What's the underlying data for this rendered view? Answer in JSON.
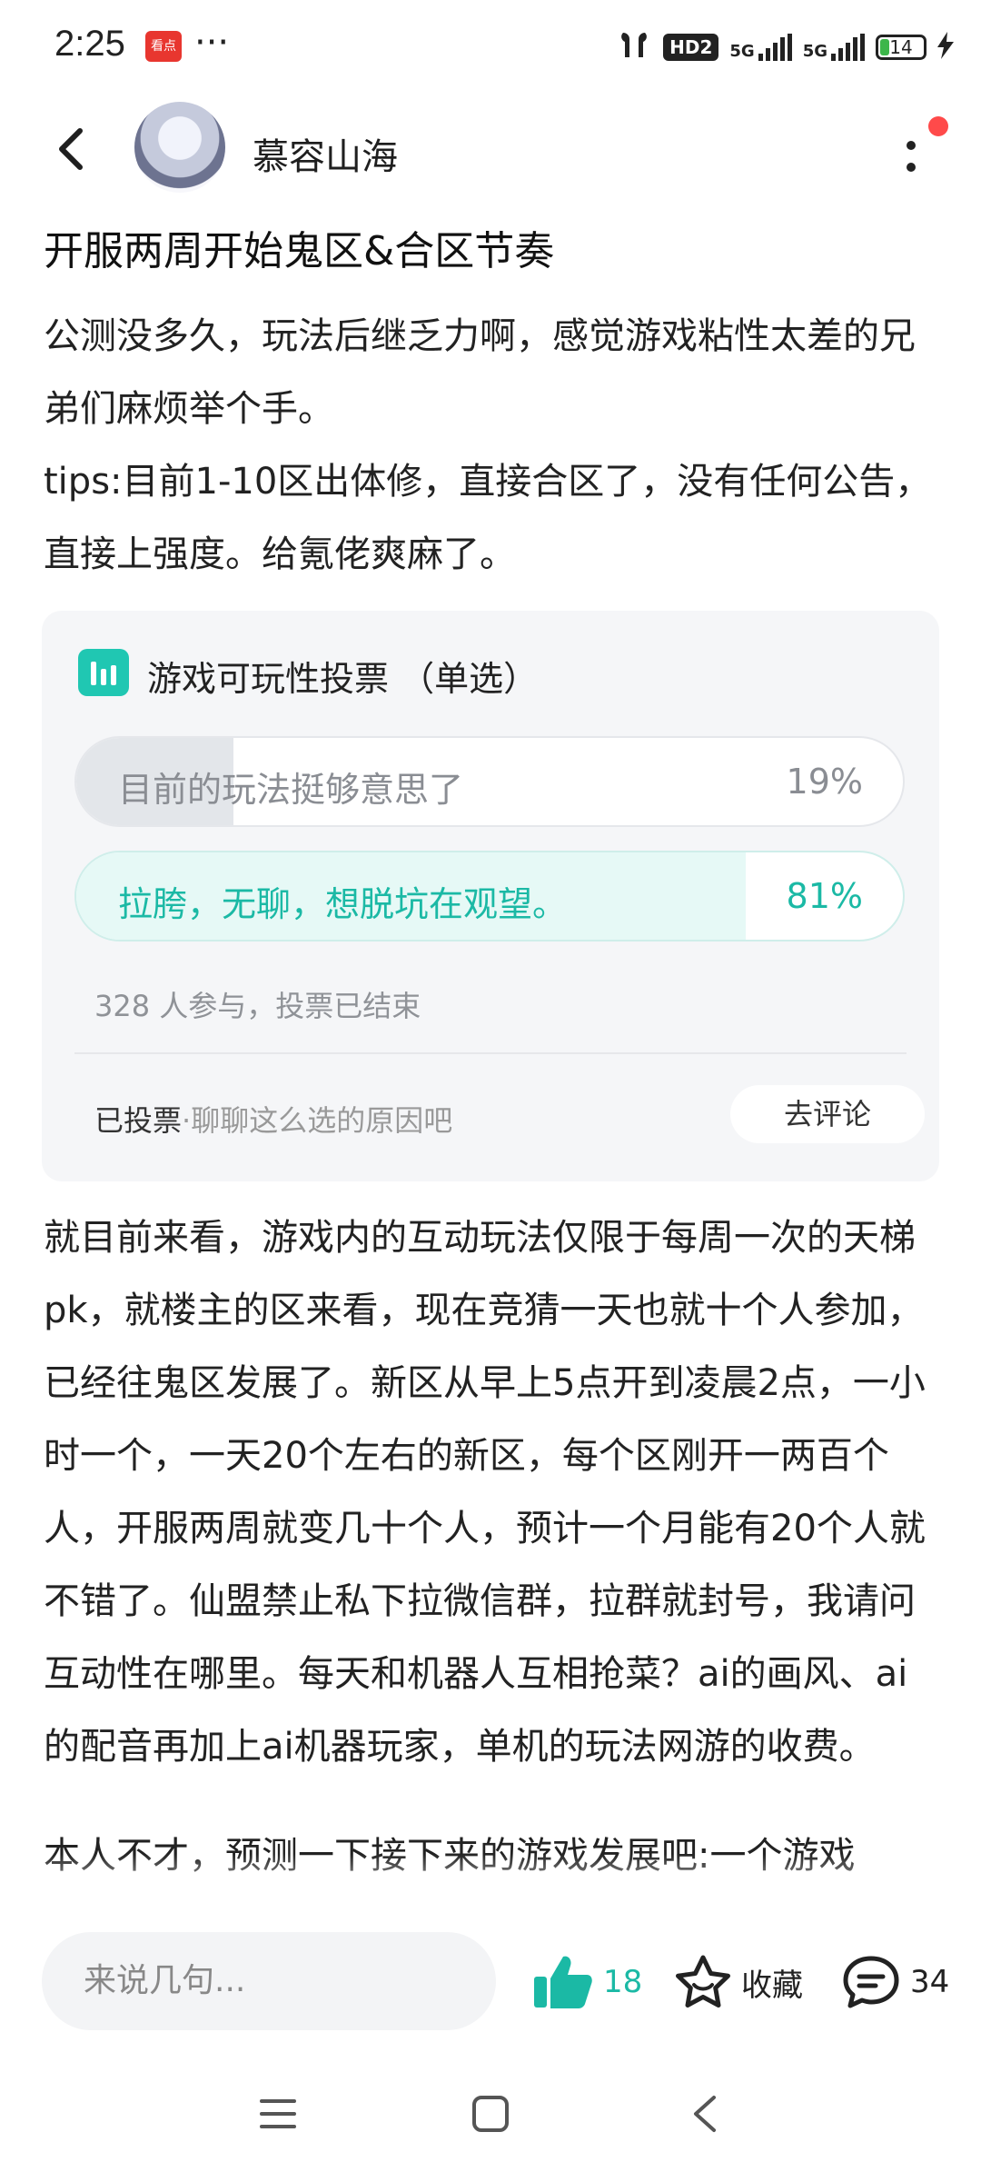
{
  "status_bar": {
    "time": "2:25",
    "app_icon_text": "看点",
    "more_dots": "···",
    "hd_badge": "HD2",
    "network1": "5G",
    "network2": "5G",
    "battery": "14"
  },
  "header": {
    "author": "慕容山海"
  },
  "post": {
    "title": "开服两周开始鬼区&合区节奏",
    "paragraph1": "公测没多久，玩法后继乏力啊，感觉游戏粘性太差的兄弟们麻烦举个手。",
    "paragraph2": "tips:目前1-10区出体修，直接合区了，没有任何公告，直接上强度。给氪佬爽麻了。",
    "paragraph3": "就目前来看，游戏内的互动玩法仅限于每周一次的天梯pk，就楼主的区来看，现在竞猜一天也就十个人参加，已经往鬼区发展了。新区从早上5点开到凌晨2点，一小时一个，一天20个左右的新区，每个区刚开一两百个人，开服两周就变几十个人，预计一个月能有20个人就不错了。仙盟禁止私下拉微信群，拉群就封号，我请问互动性在哪里。每天和机器人互相抢菜？ai的画风、ai的配音再加上ai机器玩家，单机的玩法网游的收费。",
    "paragraph4": "本人不才，预测一下接下来的游戏发展吧:一个游戏"
  },
  "vote": {
    "title": "游戏可玩性投票 （单选）",
    "options": [
      {
        "label": "目前的玩法挺够意思了",
        "percent_text": "19%",
        "percent": 19
      },
      {
        "label": "拉胯，无聊，想脱坑在观望。",
        "percent_text": "81%",
        "percent": 81
      }
    ],
    "meta": "328 人参与，投票已结束",
    "voted_label": "已投票",
    "voted_sub": "·聊聊这么选的原因吧",
    "comment_button": "去评论"
  },
  "bottom_bar": {
    "input_placeholder": "来说几句...",
    "like_count": "18",
    "favorite_label": "收藏",
    "comment_count": "34"
  },
  "icons": {
    "back": "back-arrow-icon",
    "more": "more-vertical-icon",
    "vote": "bar-chart-icon",
    "like": "thumbs-up-icon",
    "favorite": "star-icon",
    "comment": "chat-bubble-icon"
  },
  "colors": {
    "accent": "#1bb9a5",
    "notification": "#ff4a4a"
  }
}
